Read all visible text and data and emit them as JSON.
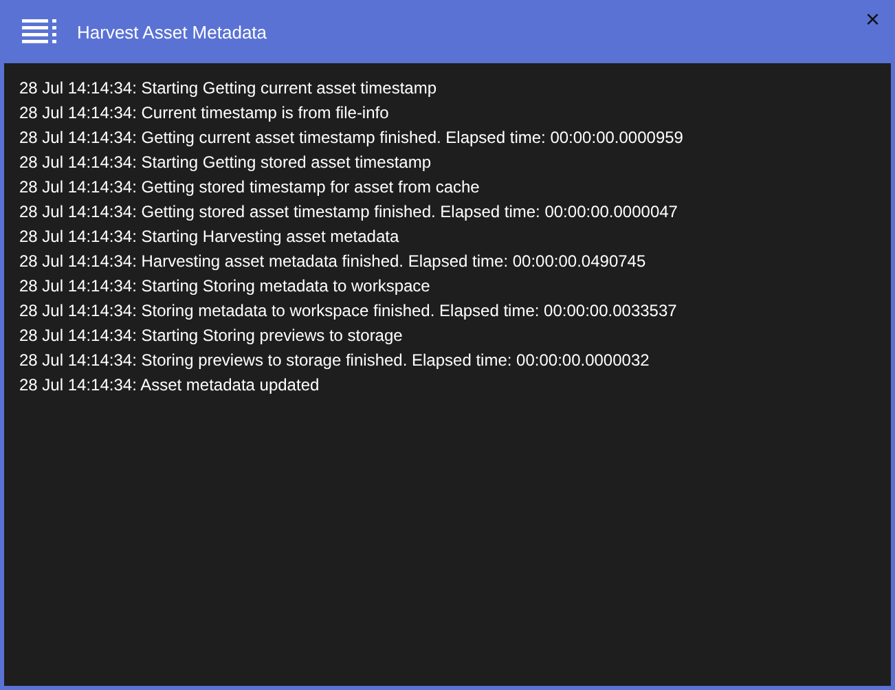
{
  "window": {
    "title": "Harvest Asset Metadata",
    "close": "×"
  },
  "log": [
    "28 Jul 14:14:34: Starting Getting current asset timestamp",
    "28 Jul 14:14:34: Current timestamp is from file-info",
    "28 Jul 14:14:34: Getting current asset timestamp finished. Elapsed time: 00:00:00.0000959",
    "28 Jul 14:14:34: Starting Getting stored asset timestamp",
    "28 Jul 14:14:34: Getting stored timestamp for asset from cache",
    "28 Jul 14:14:34: Getting stored asset timestamp finished. Elapsed time: 00:00:00.0000047",
    "28 Jul 14:14:34: Starting Harvesting asset metadata",
    "28 Jul 14:14:34: Harvesting asset metadata finished. Elapsed time: 00:00:00.0490745",
    "28 Jul 14:14:34: Starting Storing metadata to workspace",
    "28 Jul 14:14:34: Storing metadata to workspace finished. Elapsed time: 00:00:00.0033537",
    "28 Jul 14:14:34: Starting Storing previews to storage",
    "28 Jul 14:14:34: Storing previews to storage finished. Elapsed time: 00:00:00.0000032",
    "28 Jul 14:14:34: Asset metadata updated"
  ]
}
